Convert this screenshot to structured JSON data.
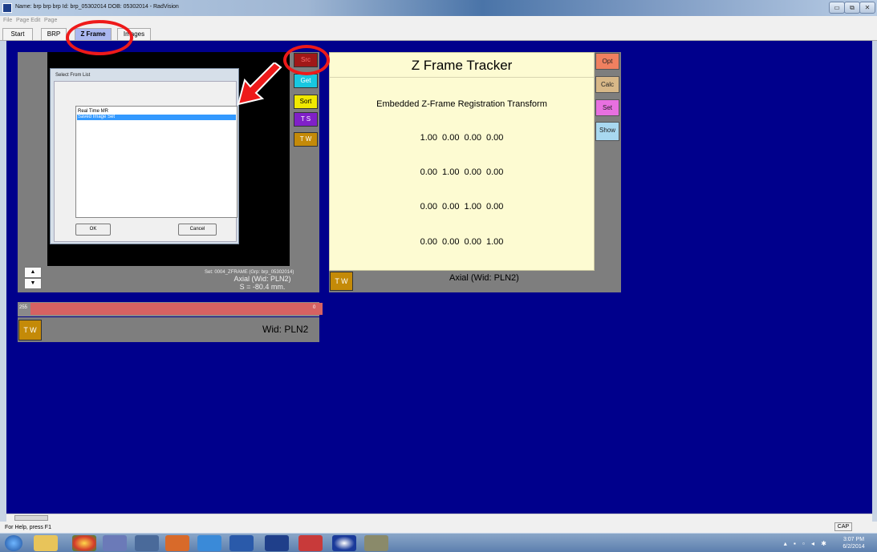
{
  "window": {
    "title": "Name: brp brp brp   Id: brp_05302014   DOB: 05302014 - RadVision",
    "controls": [
      "▭",
      "⧉",
      "✕"
    ]
  },
  "menu": {
    "items": [
      "File",
      "Page Edit",
      "Page"
    ]
  },
  "tabs": [
    "Start",
    "BRP",
    "Z Frame",
    "Images"
  ],
  "active_tab": "Z Frame",
  "left_view": {
    "dialog": {
      "title": "Select From List",
      "options": [
        "Real Time MR",
        "Saved Image Set"
      ],
      "selected": "Saved Image Set",
      "ok_label": "OK",
      "cancel_label": "Cancel"
    },
    "buttons": {
      "src": "Src",
      "get": "Get",
      "sort": "Sort",
      "ts": "T S",
      "tw": "T W"
    },
    "set_info": "Set: 0004_ZFRAME (Grp: brp_05302014)",
    "plane": "Axial (Wid: PLN2)",
    "position": "S = -80.4 mm.",
    "scroll_up": "▲",
    "scroll_down": "▼"
  },
  "colorbar": {
    "max_label": "255",
    "min_label": "0"
  },
  "window_strip": {
    "tw_label": "T W",
    "wid_label": "Wid: PLN2"
  },
  "tracker": {
    "title": "Z Frame Tracker",
    "subtitle": "Embedded Z-Frame Registration Transform",
    "matrix": [
      "1.00  0.00  0.00  0.00",
      "0.00  1.00  0.00  0.00",
      "0.00  0.00  1.00  0.00",
      "0.00  0.00  0.00  1.00"
    ],
    "buttons": {
      "opt": "Opt",
      "calc": "Calc",
      "set": "Set",
      "show": "Show"
    },
    "tw_label": "T W",
    "plane": "Axial (Wid: PLN2)"
  },
  "status": {
    "help": "For Help, press F1",
    "cap": "CAP"
  },
  "taskbar": {
    "time": "3:07 PM",
    "date": "6/2/2014"
  },
  "colors": {
    "client_bg": "#00008c",
    "tracker_bg": "#fdfbd2",
    "annotation": "#ee1a1a",
    "src": "#a01818",
    "get": "#18c8e0",
    "sort": "#f0e800",
    "ts": "#8020c8",
    "tw": "#c48a08",
    "opt": "#f08060",
    "calc": "#d8b888",
    "set": "#e870e0",
    "show": "#a8d8f0"
  }
}
